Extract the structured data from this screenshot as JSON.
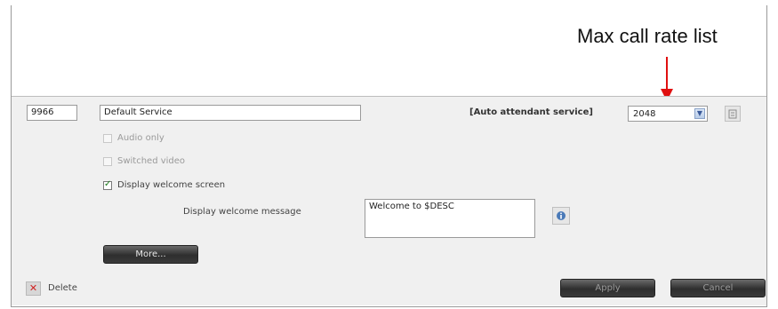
{
  "annotation": {
    "callout_label": "Max call rate list"
  },
  "service": {
    "number": "9966",
    "name": "Default Service",
    "auto_attendant_label": "[Auto attendant service]",
    "max_call_rate": "2048"
  },
  "options": {
    "audio_only": "Audio only",
    "switched_video": "Switched video",
    "display_welcome_screen": "Display welcome screen",
    "display_welcome_screen_checked": true
  },
  "welcome": {
    "label": "Display welcome message",
    "message": "Welcome to $DESC"
  },
  "buttons": {
    "more": "More...",
    "delete": "Delete",
    "apply": "Apply",
    "cancel": "Cancel"
  },
  "colors": {
    "callout_arrow": "#e01010",
    "accent_link": "#1a5fb4",
    "button_dark": "#2e2e2e"
  },
  "icons": {
    "dropdown": "chevron-down-icon",
    "info": "info-icon",
    "rate_info": "list-icon",
    "delete": "close-icon"
  }
}
